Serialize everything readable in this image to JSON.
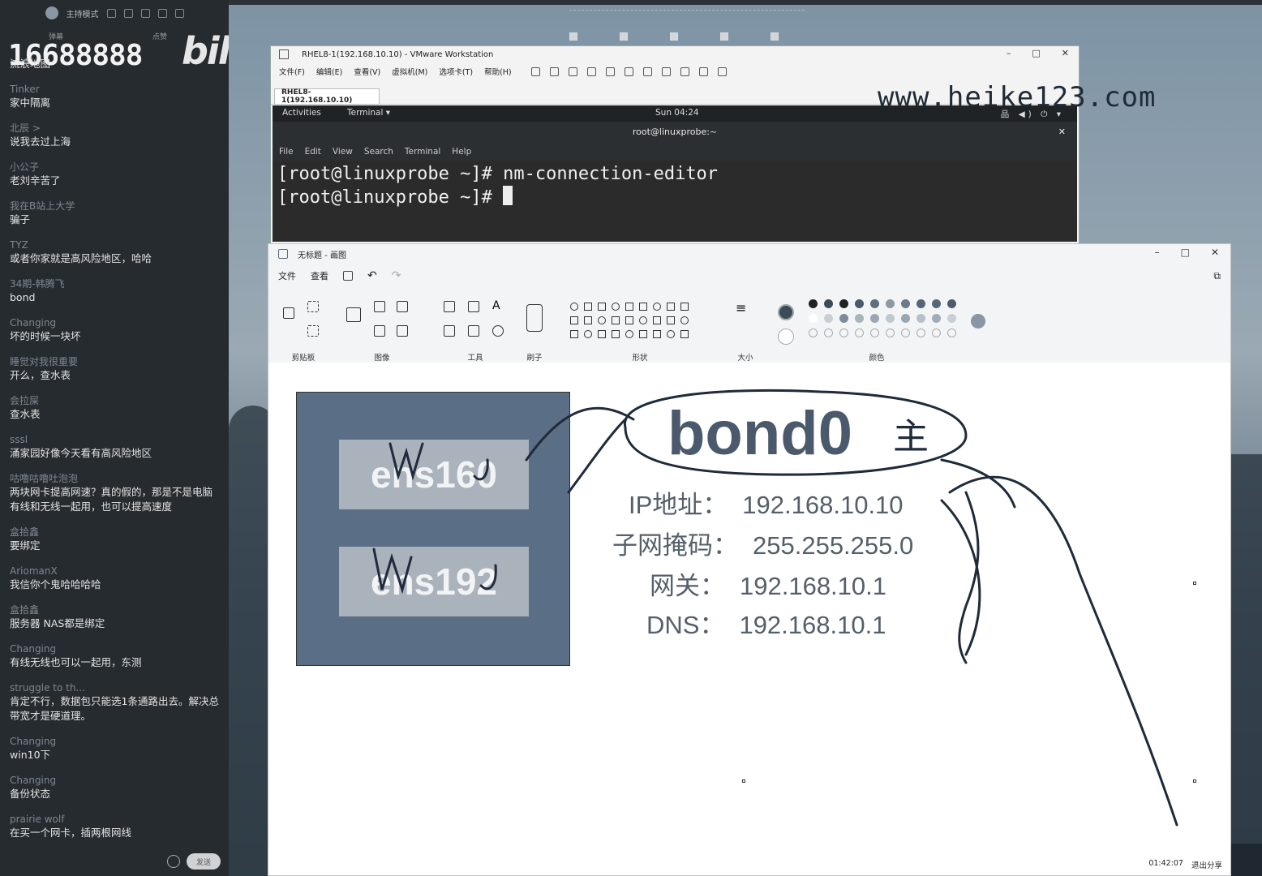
{
  "chat": {
    "topbar_mode": "主持模式",
    "subtab_left": "弹幕",
    "subtab_right": "点赞",
    "counter": "16688888",
    "brand": "bilibili",
    "send_label": "发送",
    "messages": [
      {
        "user": "",
        "text": "流浪地图"
      },
      {
        "user": "Tinker",
        "text": "家中隔离"
      },
      {
        "user": "北辰 >",
        "text": "说我去过上海"
      },
      {
        "user": "小公子",
        "text": "老刘辛苦了"
      },
      {
        "user": "我在B站上大学",
        "text": "骗子"
      },
      {
        "user": "TYZ",
        "text": "或者你家就是高风险地区，哈哈"
      },
      {
        "user": "34期-韩腾飞",
        "text": "bond"
      },
      {
        "user": "Changing",
        "text": "坏的时候一块坏"
      },
      {
        "user": "睡觉对我很重要",
        "text": "开么，查水表"
      },
      {
        "user": "会拉屎",
        "text": "查水表"
      },
      {
        "user": "sssl",
        "text": "涌家园好像今天看有高风险地区"
      },
      {
        "user": "咕噜咕噜吐泡泡",
        "text": "两块网卡提高网速？真的假的，那是不是电脑有线和无线一起用，也可以提高速度"
      },
      {
        "user": "盒拾鑫",
        "text": "要绑定"
      },
      {
        "user": "AriomanX",
        "text": "我信你个鬼哈哈哈哈"
      },
      {
        "user": "盒拾鑫",
        "text": "服务器 NAS都是绑定"
      },
      {
        "user": "Changing",
        "text": "有线无线也可以一起用，东测"
      },
      {
        "user": "struggle to th...",
        "text": "肯定不行，数据包只能选1条通路出去。解决总带宽才是硬道理。"
      },
      {
        "user": "Changing",
        "text": "win10下"
      },
      {
        "user": "Changing",
        "text": "备份状态"
      },
      {
        "user": "prairie wolf",
        "text": "在买一个网卡，插两根网线"
      }
    ]
  },
  "watermark": "www.heike123.com",
  "vmware": {
    "title": "RHEL8-1(192.168.10.10) - VMware Workstation",
    "menu": [
      "文件(F)",
      "编辑(E)",
      "查看(V)",
      "虚拟机(M)",
      "选项卡(T)",
      "帮助(H)"
    ],
    "vm_tab": "RHEL8-1(192.168.10.10)",
    "gnome": {
      "activities": "Activities",
      "app": "Terminal ▾",
      "clock": "Sun 04:24",
      "sys": "品 ◀) ⏻ ▾"
    },
    "terminal": {
      "title": "root@linuxprobe:~",
      "menu": [
        "File",
        "Edit",
        "View",
        "Search",
        "Terminal",
        "Help"
      ],
      "lines": [
        "[root@linuxprobe ~]# nm-connection-editor",
        "[root@linuxprobe ~]# "
      ]
    }
  },
  "paint": {
    "title": "无标题 - 画图",
    "menu": [
      "文件",
      "查看"
    ],
    "groups": {
      "clipboard": "剪贴板",
      "image": "图像",
      "tools": "工具",
      "brushes": "刷子",
      "shapes": "形状",
      "size": "大小",
      "colors": "颜色"
    },
    "canvas": {
      "nic1": "ens160",
      "nic2": "ens192",
      "bond": "bond0",
      "bond_note": "主",
      "info": [
        {
          "k": "IP地址：",
          "v": "192.168.10.10"
        },
        {
          "k": "子网掩码：",
          "v": "255.255.255.0"
        },
        {
          "k": "网关：",
          "v": "192.168.10.1"
        },
        {
          "k": "DNS：",
          "v": "192.168.10.1"
        }
      ]
    },
    "status": {
      "time": "01:42:07",
      "label": "退出分享"
    }
  }
}
